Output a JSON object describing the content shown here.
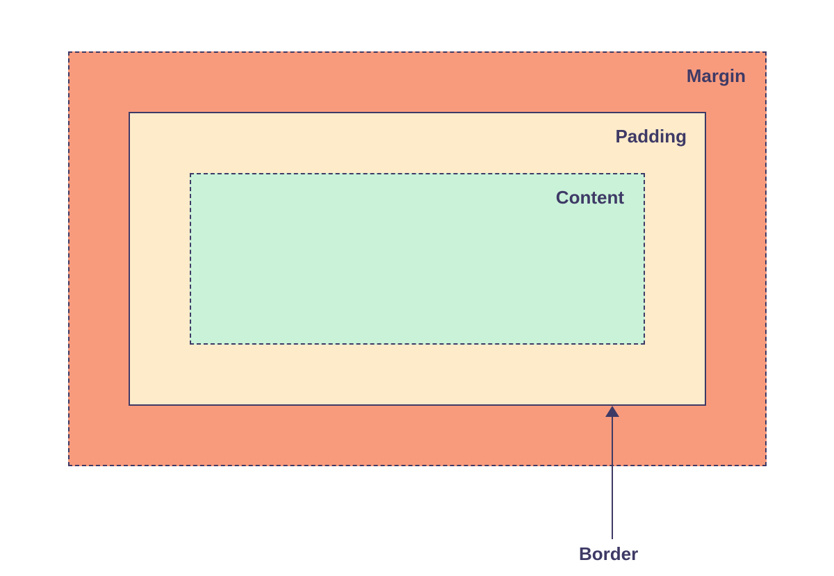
{
  "diagram": {
    "type": "css-box-model",
    "layers": {
      "margin": {
        "label": "Margin",
        "color": "#f89b7d",
        "border_style": "dashed"
      },
      "padding": {
        "label": "Padding",
        "color": "#fdebca",
        "border_style": "solid"
      },
      "content": {
        "label": "Content",
        "color": "#caf2d8",
        "border_style": "dashed"
      }
    },
    "border_label": "Border",
    "text_color": "#3e3a66"
  }
}
